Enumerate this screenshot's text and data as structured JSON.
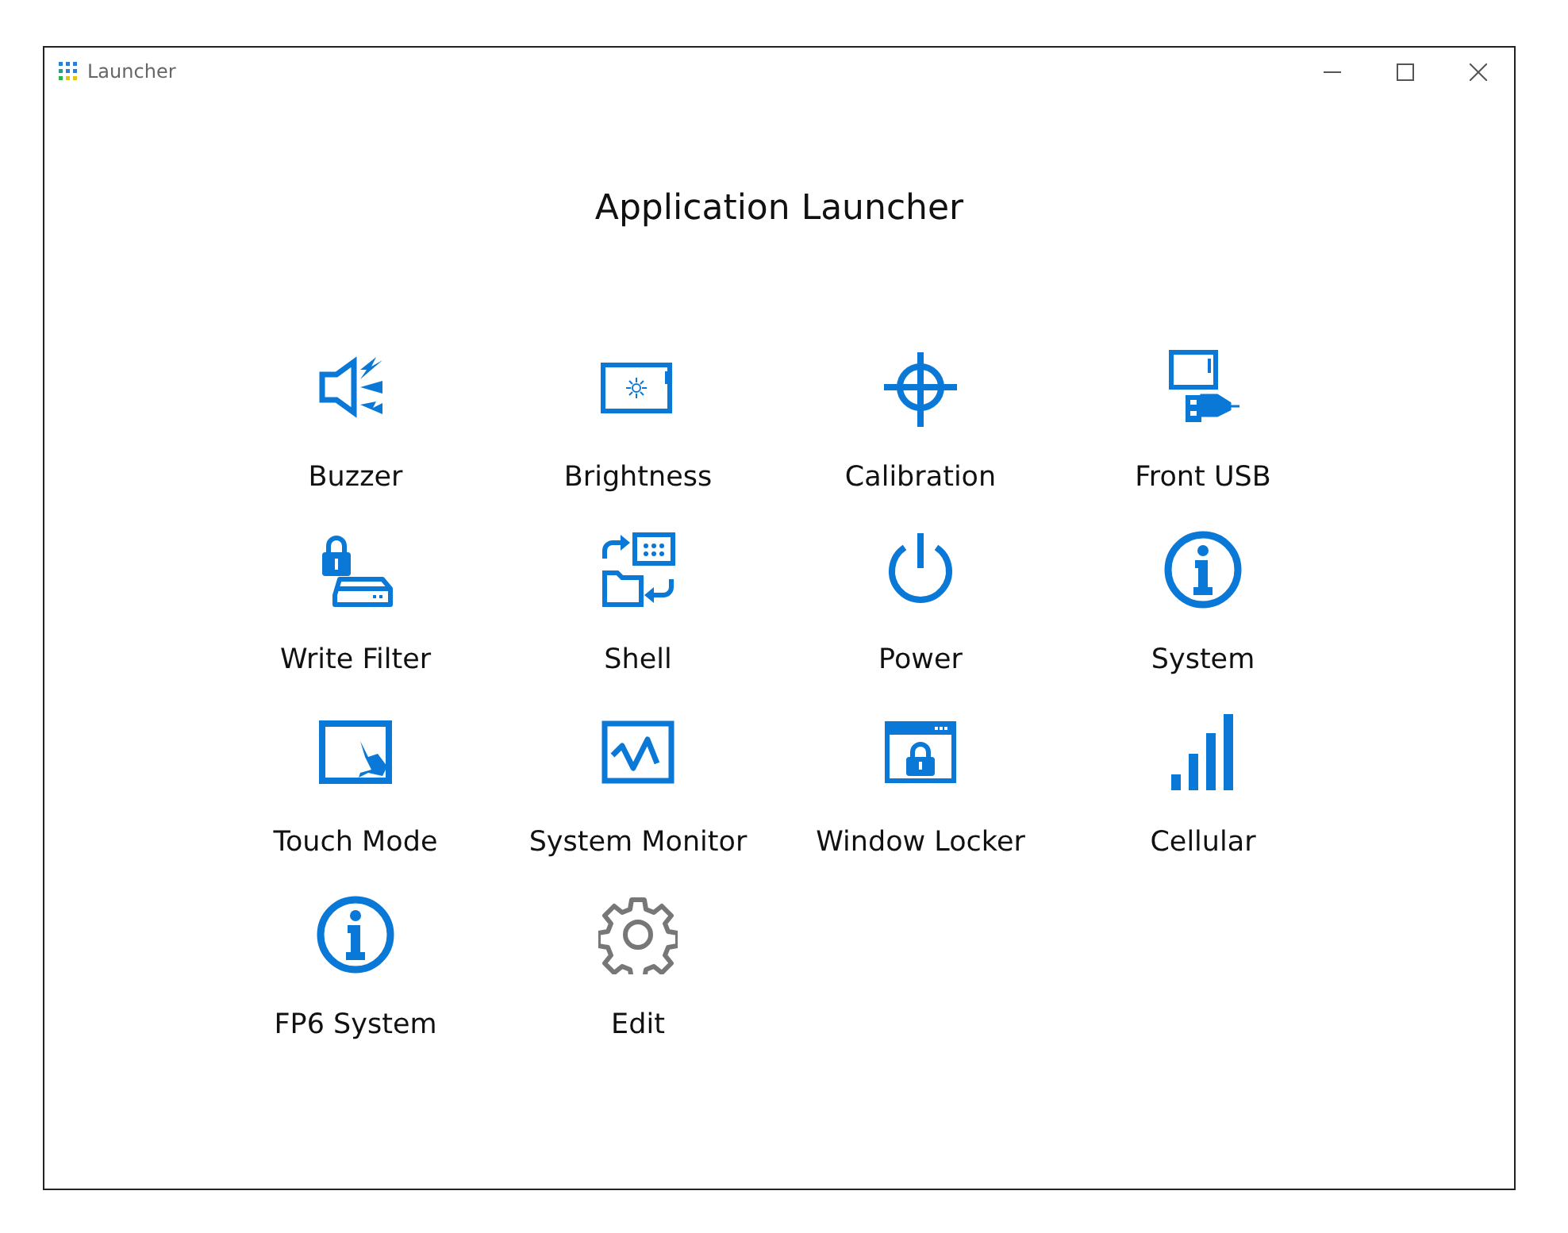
{
  "window": {
    "title": "Launcher"
  },
  "heading": "Application Launcher",
  "tiles": [
    {
      "label": "Buzzer",
      "kind": "speaker"
    },
    {
      "label": "Brightness",
      "kind": "brightness"
    },
    {
      "label": "Calibration",
      "kind": "crosshair"
    },
    {
      "label": "Front USB",
      "kind": "usb"
    },
    {
      "label": "Write Filter",
      "kind": "lockdrive"
    },
    {
      "label": "Shell",
      "kind": "shell"
    },
    {
      "label": "Power",
      "kind": "power"
    },
    {
      "label": "System",
      "kind": "info"
    },
    {
      "label": "Touch Mode",
      "kind": "touch"
    },
    {
      "label": "System Monitor",
      "kind": "monitor"
    },
    {
      "label": "Window Locker",
      "kind": "windowlock"
    },
    {
      "label": "Cellular",
      "kind": "signal"
    },
    {
      "label": "FP6 System",
      "kind": "info"
    },
    {
      "label": "Edit",
      "kind": "gear"
    }
  ]
}
